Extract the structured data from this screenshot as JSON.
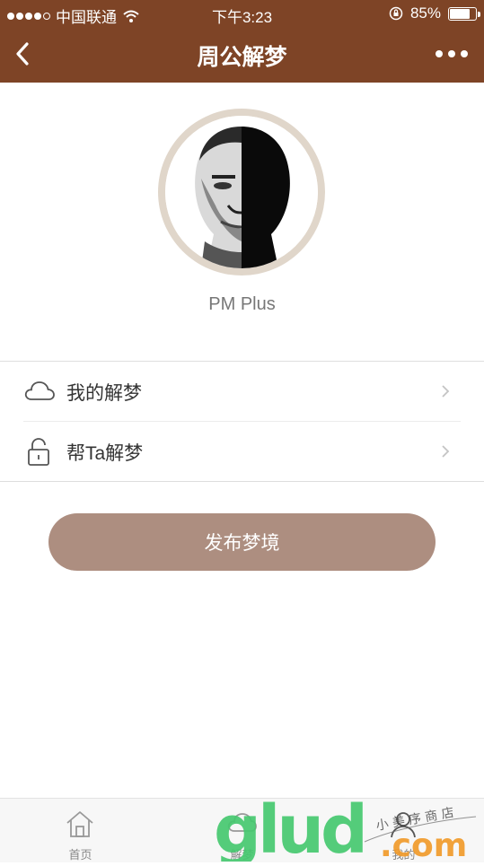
{
  "status_bar": {
    "carrier": "中国联通",
    "time": "下午3:23",
    "battery": "85%",
    "battery_level": 0.85,
    "signal_bars_filled": 4,
    "signal_bars_total": 5
  },
  "nav": {
    "title": "周公解梦",
    "back_icon": "chevron-left-icon",
    "more_icon": "more-dots-icon"
  },
  "profile": {
    "name": "PM Plus"
  },
  "menu": [
    {
      "label": "我的解梦",
      "icon": "cloud-icon"
    },
    {
      "label": "帮Ta解梦",
      "icon": "unlock-icon"
    }
  ],
  "publish_button": "发布梦境",
  "tabs": [
    {
      "label": "首页",
      "icon": "home-icon"
    },
    {
      "label": "解梦",
      "icon": "dream-icon"
    },
    {
      "label": "我的",
      "icon": "user-icon"
    }
  ],
  "watermark": {
    "brand": "glud",
    "suffix": ".com",
    "tagline": "小 美 序 商 店"
  },
  "colors": {
    "header": "#7e4426",
    "button": "#ad8e80",
    "avatar_ring": "#e0d6ca",
    "watermark_green": "#45c86f",
    "watermark_orange": "#f09a2a"
  }
}
